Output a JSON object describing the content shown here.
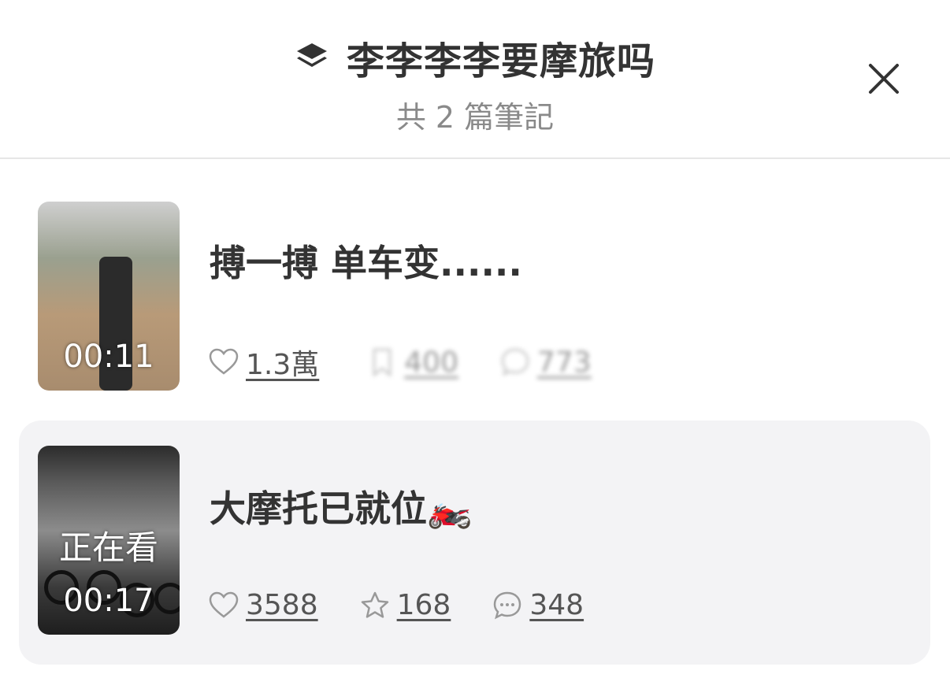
{
  "header": {
    "title": "李李李李要摩旅吗",
    "subtitle": "共 2 篇筆記",
    "collection_icon": "layers-icon",
    "close_icon": "close-icon"
  },
  "notes": [
    {
      "title": "搏一搏 单车变......",
      "duration": "00:11",
      "likes": "1.3萬",
      "collects": "400",
      "comments": "773",
      "active": false
    },
    {
      "title": "大摩托已就位🏍️",
      "duration": "00:17",
      "watching_label": "正在看",
      "likes": "3588",
      "collects": "168",
      "comments": "348",
      "active": true
    }
  ],
  "colors": {
    "active_card_bg": "#f3f3f5",
    "divider": "#e6e6e6",
    "text_primary": "#333333",
    "text_secondary": "#8a8a8a"
  }
}
